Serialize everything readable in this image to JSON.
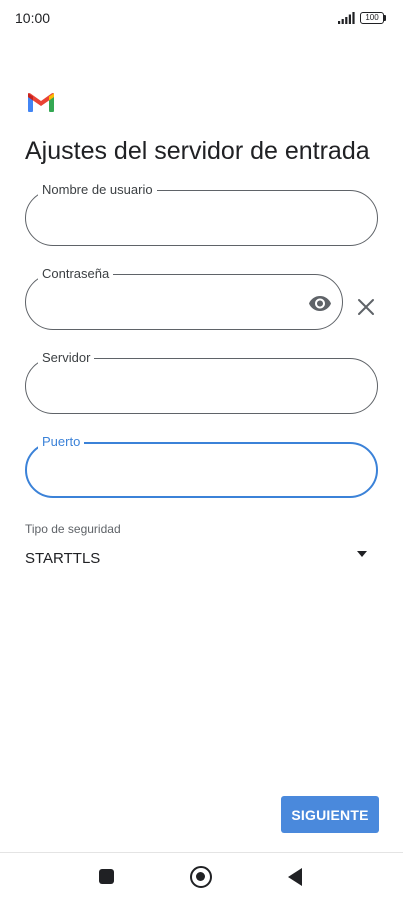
{
  "status_bar": {
    "time": "10:00",
    "battery": "100",
    "icons": [
      "signal-icon",
      "battery-icon"
    ]
  },
  "app": {
    "logo_icon": "gmail-logo",
    "title": "Ajustes del servidor de entrada"
  },
  "form": {
    "username": {
      "label": "Nombre de usuario",
      "value": ""
    },
    "password": {
      "label": "Contraseña",
      "value": "",
      "toggle_icon": "eye-icon",
      "clear_icon": "close-icon"
    },
    "server": {
      "label": "Servidor",
      "value": ""
    },
    "port": {
      "label": "Puerto",
      "value": "",
      "focused": true
    },
    "security": {
      "label": "Tipo de seguridad",
      "selected": "STARTTLS"
    }
  },
  "actions": {
    "next_label": "SIGUIENTE"
  },
  "nav_bar": {
    "icons": [
      "recents-icon",
      "home-icon",
      "back-icon"
    ]
  },
  "colors": {
    "accent": "#4a89dc",
    "focus": "#3b82d8",
    "text": "#202124",
    "outline": "#5f6368"
  }
}
